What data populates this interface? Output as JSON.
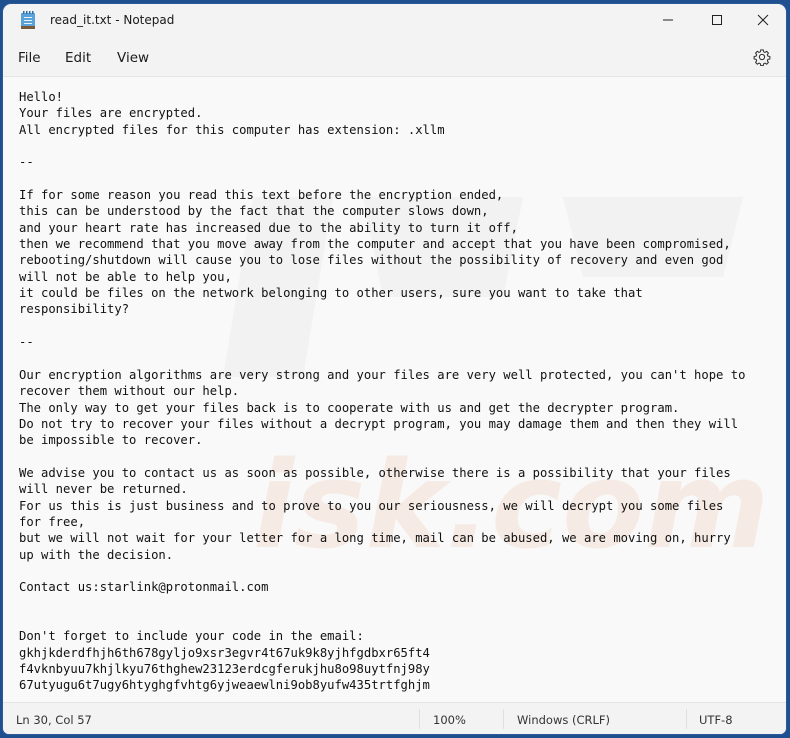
{
  "window": {
    "title": "read_it.txt - Notepad",
    "app_icon": "notepad-icon",
    "controls": {
      "minimize": "minimize-icon",
      "maximize": "maximize-icon",
      "close": "close-icon"
    }
  },
  "menubar": {
    "items": [
      {
        "label": "File"
      },
      {
        "label": "Edit"
      },
      {
        "label": "View"
      }
    ],
    "settings_icon": "gear-icon"
  },
  "editor": {
    "lines": [
      "Hello!",
      "Your files are encrypted.",
      "All encrypted files for this computer has extension: .xllm",
      "",
      "--",
      "",
      "If for some reason you read this text before the encryption ended,",
      "this can be understood by the fact that the computer slows down,",
      "and your heart rate has increased due to the ability to turn it off,",
      "then we recommend that you move away from the computer and accept that you have been compromised,",
      "rebooting/shutdown will cause you to lose files without the possibility of recovery and even god",
      "will not be able to help you,",
      "it could be files on the network belonging to other users, sure you want to take that",
      "responsibility?",
      "",
      "--",
      "",
      "Our encryption algorithms are very strong and your files are very well protected, you can't hope to",
      "recover them without our help.",
      "The only way to get your files back is to cooperate with us and get the decrypter program.",
      "Do not try to recover your files without a decrypt program, you may damage them and then they will",
      "be impossible to recover.",
      "",
      "We advise you to contact us as soon as possible, otherwise there is a possibility that your files",
      "will never be returned.",
      "For us this is just business and to prove to you our seriousness, we will decrypt you some files",
      "for free,",
      "but we will not wait for your letter for a long time, mail can be abused, we are moving on, hurry",
      "up with the decision.",
      "",
      "Contact us:starlink@protonmail.com",
      "",
      "",
      "Don't forget to include your code in the email:",
      "gkhjkderdfhjh6th678gyljo9xsr3egvr4t67uk9k8yjhfgdbxr65ft4",
      "f4vknbyuu7khjlkyu76thghew23123erdcgferukjhu8o98uytfnj98y",
      "67utyugu6t7ugy6htyghgfvhtg6yjweaewlni9ob8yufw435trtfghjm"
    ]
  },
  "statusbar": {
    "position": "Ln 30, Col 57",
    "zoom": "100%",
    "line_ending": "Windows (CRLF)",
    "encoding": "UTF-8"
  }
}
